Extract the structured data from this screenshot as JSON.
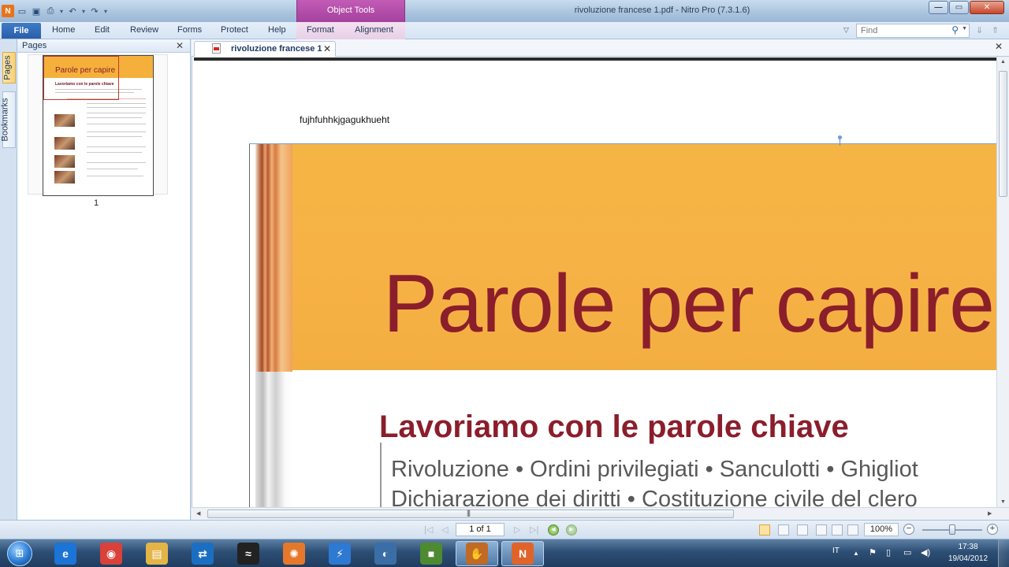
{
  "window": {
    "title": "rivoluzione francese 1.pdf - Nitro Pro (7.3.1.6)",
    "context_group": "Object Tools"
  },
  "ribbon": {
    "file": "File",
    "tabs": [
      "Home",
      "Edit",
      "Review",
      "Forms",
      "Protect",
      "Help",
      "Format",
      "Alignment"
    ],
    "find_placeholder": "Find"
  },
  "side_tabs": {
    "pages": "Pages",
    "bookmarks": "Bookmarks"
  },
  "pages_panel": {
    "title": "Pages",
    "thumbnail_title": "Parole per capire",
    "thumbnail_subtitle": "Lavoriamo con le parole chiave",
    "page_number": "1"
  },
  "document": {
    "tab_label": "rivoluzione francese 1",
    "annotation_text": "fujhfuhhkjgagukhueht",
    "page": {
      "title": "Parole per capire",
      "subtitle": "Lavoriamo con le parole chiave",
      "keywords_line1": "Rivoluzione • Ordini privilegiati • Sanculotti • Ghigliot",
      "keywords_line2": "Dichiarazione dei diritti • Costituzione civile del clero"
    }
  },
  "statusbar": {
    "page_indicator": "1 of 1",
    "zoom": "100%",
    "zoom_level": 0.5
  },
  "taskbar": {
    "apps": [
      {
        "name": "internet-explorer",
        "glyph": "e",
        "color": "#1b74d6"
      },
      {
        "name": "chrome",
        "glyph": "◉",
        "color": "#d9413a"
      },
      {
        "name": "file-explorer",
        "glyph": "▤",
        "color": "#e3b448"
      },
      {
        "name": "teamviewer",
        "glyph": "⇄",
        "color": "#1b6fc2"
      },
      {
        "name": "app-black",
        "glyph": "≈",
        "color": "#222222"
      },
      {
        "name": "app-orange-gear",
        "glyph": "✺",
        "color": "#e5782a"
      },
      {
        "name": "app-lightning",
        "glyph": "⚡",
        "color": "#2e79d2"
      },
      {
        "name": "app-blue-circle",
        "glyph": "◐",
        "color": "#3b6ea6"
      },
      {
        "name": "minecraft",
        "glyph": "■",
        "color": "#4d8a32"
      },
      {
        "name": "app-glove",
        "glyph": "✋",
        "color": "#c06a25"
      },
      {
        "name": "nitro-pro",
        "glyph": "N",
        "color": "#e0642a"
      }
    ],
    "language": "IT",
    "clock_time": "17:38",
    "clock_date": "19/04/2012"
  },
  "colors": {
    "accent": "#2a5ea8",
    "context_tab": "#a4429d",
    "page_orange": "#f7b246",
    "title_red": "#8b1e2b"
  }
}
